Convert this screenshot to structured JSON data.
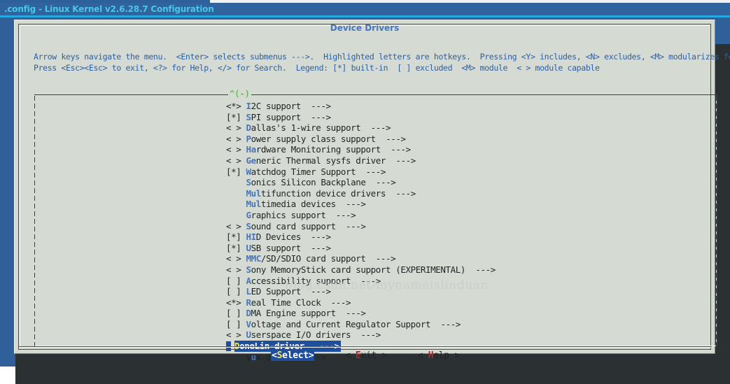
{
  "window": {
    "title": ".config - Linux Kernel v2.6.28.7 Configuration",
    "dialog_heading": "Device Drivers"
  },
  "help": {
    "line1": "Arrow keys navigate the menu.  <Enter> selects submenus --->.  Highlighted letters are hotkeys.  Pressing <Y> includes, <N> excludes, <M> modularizes features.",
    "line2": "Press <Esc><Esc> to exit, <?> for Help, </> for Search.  Legend: [*] built-in  [ ] excluded  <M> module  < > module capable"
  },
  "scroll": {
    "up_marker": "^(-)"
  },
  "menu": {
    "items": [
      {
        "tag": "<*>",
        "hot": "I",
        "pre": "",
        "text": "2C support",
        "arrow": "--->"
      },
      {
        "tag": "[*]",
        "hot": "S",
        "pre": "",
        "text": "PI support",
        "arrow": "--->"
      },
      {
        "tag": "< >",
        "hot": "D",
        "pre": "",
        "text": "allas's 1-wire support",
        "arrow": "--->"
      },
      {
        "tag": "< >",
        "hot": "P",
        "pre": "",
        "text": "ower supply class support",
        "arrow": "--->"
      },
      {
        "tag": "< >",
        "hot": "Ha",
        "pre": "",
        "text": "rdware Monitoring support",
        "arrow": "--->"
      },
      {
        "tag": "< >",
        "hot": "Ge",
        "pre": "",
        "text": "neric Thermal sysfs driver",
        "arrow": "--->"
      },
      {
        "tag": "[*]",
        "hot": "W",
        "pre": "",
        "text": "atchdog Timer Support",
        "arrow": "--->"
      },
      {
        "tag": "   ",
        "hot": "S",
        "pre": "",
        "text": "onics Silicon Backplane",
        "arrow": "--->"
      },
      {
        "tag": "   ",
        "hot": "Mul",
        "pre": "",
        "text": "tifunction device drivers",
        "arrow": "--->"
      },
      {
        "tag": "   ",
        "hot": "Mul",
        "pre": "",
        "text": "timedia devices",
        "arrow": "--->"
      },
      {
        "tag": "   ",
        "hot": "G",
        "pre": "",
        "text": "raphics support",
        "arrow": "--->"
      },
      {
        "tag": "< >",
        "hot": "S",
        "pre": "",
        "text": "ound card support",
        "arrow": "--->"
      },
      {
        "tag": "[*]",
        "hot": "HI",
        "pre": "",
        "text": "D Devices",
        "arrow": "--->"
      },
      {
        "tag": "[*]",
        "hot": "U",
        "pre": "",
        "text": "SB support",
        "arrow": "--->"
      },
      {
        "tag": "< >",
        "hot": "MMC",
        "pre": "",
        "text": "/SD/SDIO card support",
        "arrow": "--->"
      },
      {
        "tag": "< >",
        "hot": "S",
        "pre": "",
        "text": "ony MemoryStick card support (EXPERIMENTAL)",
        "arrow": "--->"
      },
      {
        "tag": "[ ]",
        "hot": "A",
        "pre": "",
        "text": "ccessibility support",
        "arrow": "--->"
      },
      {
        "tag": "[ ]",
        "hot": "L",
        "pre": "",
        "text": "ED Support",
        "arrow": "--->"
      },
      {
        "tag": "<*>",
        "hot": "R",
        "pre": "",
        "text": "eal Time Clock",
        "arrow": "--->"
      },
      {
        "tag": "[ ]",
        "hot": "D",
        "pre": "",
        "text": "MA Engine support",
        "arrow": "--->"
      },
      {
        "tag": "[ ]",
        "hot": "V",
        "pre": "",
        "text": "oltage and Current Regulator Support",
        "arrow": "--->"
      },
      {
        "tag": "< >",
        "hot": "U",
        "pre": "",
        "text": "serspace I/O drivers",
        "arrow": "--->"
      }
    ],
    "selected": {
      "hot": "D",
      "text": "oneLin-driver",
      "arrow": "--->"
    },
    "after_selected": {
      "tag": "   ",
      "hot_pre": "y",
      "hot": "u",
      "text": "x-driver",
      "arrow": "--->"
    }
  },
  "buttons": {
    "select": {
      "prefix": "<",
      "hot": "S",
      "text": "elect",
      "suffix": ">"
    },
    "exit": {
      "prefix": "< ",
      "hot": "E",
      "text": "xit",
      "suffix": " >"
    },
    "help": {
      "prefix": "< ",
      "hot": "H",
      "text": "elp",
      "suffix": " >"
    }
  },
  "watermark": {
    "text": "blog.csdn.net/mynameislinduan"
  },
  "colors": {
    "title_bar_bg": "#31639e",
    "title_text": "#49c7e8",
    "dialog_bg": "#d5dad2",
    "accent_blue": "#4876b8",
    "selection_bg": "#1e4e9c",
    "hotkey_yellow": "#f2e85c",
    "hotkey_red": "#a02b2b",
    "scroll_marker_green": "#6abd55"
  }
}
